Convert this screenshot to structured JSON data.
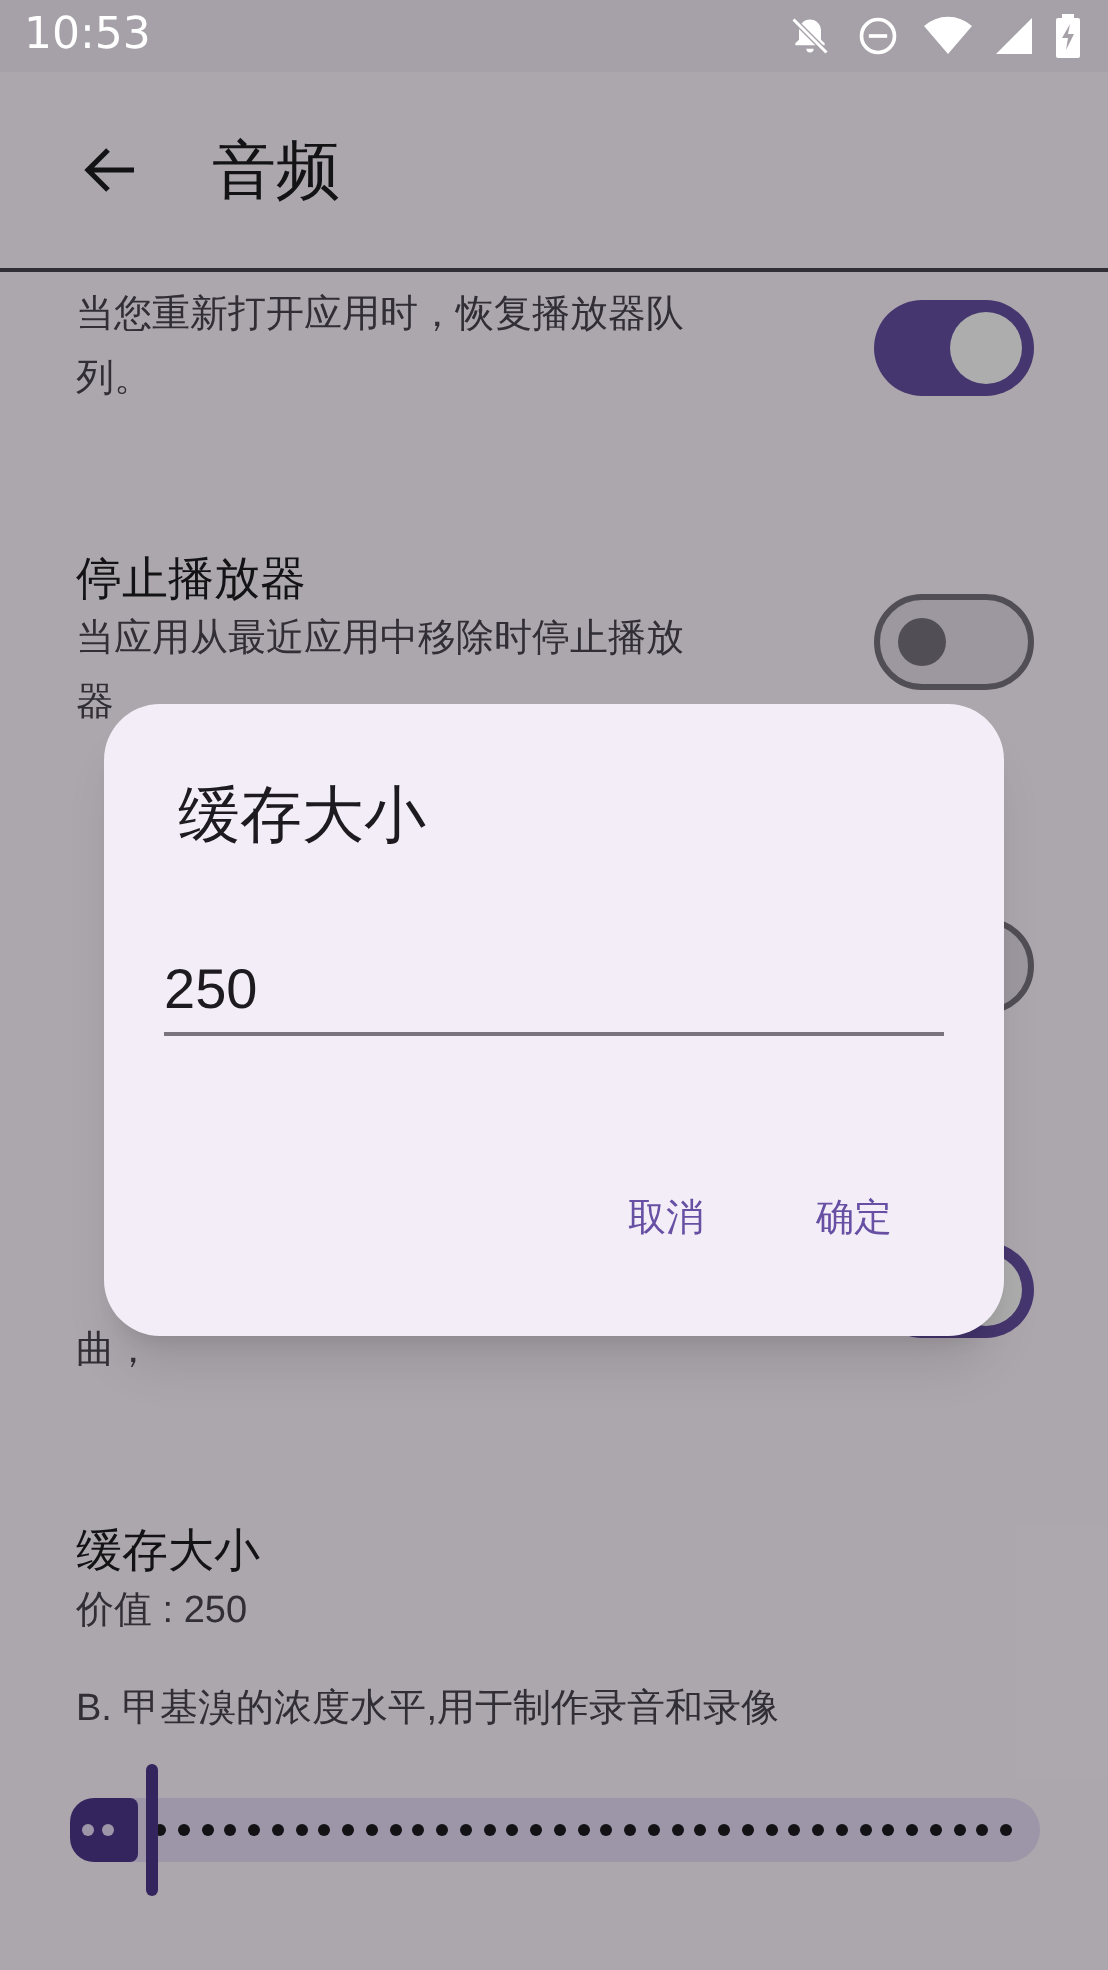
{
  "status_bar": {
    "time": "10:53"
  },
  "app_bar": {
    "title": "音频"
  },
  "settings": [
    {
      "kind": "toggle",
      "subtitle_lines": [
        "当您重新打开应用时，恢复播放器队",
        "列。"
      ],
      "on": true
    },
    {
      "kind": "toggle",
      "title": "停止播放器",
      "subtitle_lines": [
        "当应用从最近应用中移除时停止播放",
        "器"
      ],
      "on": false
    },
    {
      "kind": "toggle",
      "on": false
    },
    {
      "kind": "toggle",
      "subtitle_lines": [
        "曲，"
      ],
      "on": true
    },
    {
      "kind": "value",
      "title": "缓存大小",
      "subtitle_lines": [
        "价值 : 250"
      ]
    },
    {
      "kind": "slider",
      "label": "B. 甲基溴的浓度水平,用于制作录音和录像",
      "level": 0.07
    }
  ],
  "dialog": {
    "title": "缓存大小",
    "value": "250",
    "buttons": [
      "取消",
      "确定"
    ]
  }
}
